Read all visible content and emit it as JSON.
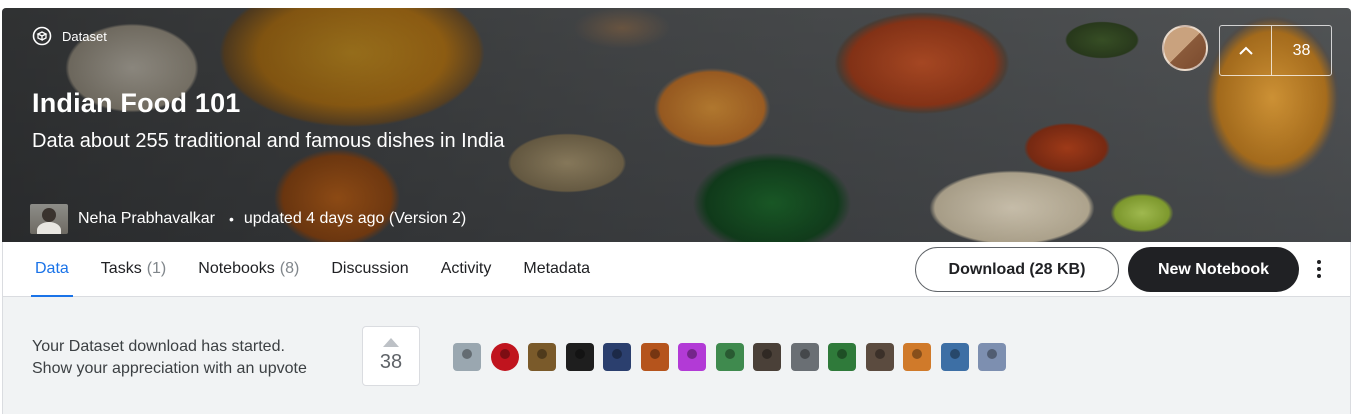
{
  "dataset": {
    "type_label": "Dataset",
    "title": "Indian Food 101",
    "subtitle": "Data about 255 traditional and famous dishes in India",
    "author": "Neha Prabhavalkar",
    "updated": "updated 4 days ago (Version 2)",
    "bullet": "•",
    "upvotes": "38"
  },
  "tabs": [
    {
      "label": "Data",
      "count": ""
    },
    {
      "label": "Tasks",
      "count": "(1)"
    },
    {
      "label": "Notebooks",
      "count": "(8)"
    },
    {
      "label": "Discussion",
      "count": ""
    },
    {
      "label": "Activity",
      "count": ""
    },
    {
      "label": "Metadata",
      "count": ""
    }
  ],
  "actions": {
    "download_label": "Download (28 KB)",
    "new_notebook_label": "New Notebook"
  },
  "notice": {
    "line1": "Your Dataset download has started.",
    "line2": "Show your appreciation with an upvote",
    "upvotes": "38"
  },
  "voter_colors": [
    "#9aa7b0",
    "#c0141e",
    "#7a5a2a",
    "#1e1e1e",
    "#2b3f6e",
    "#b5541c",
    "#b23ad6",
    "#3f8a4e",
    "#4a4038",
    "#6a6f74",
    "#2f7a3a",
    "#5b4b3f",
    "#d07a2a",
    "#3d6fa5",
    "#7d8fb0"
  ]
}
